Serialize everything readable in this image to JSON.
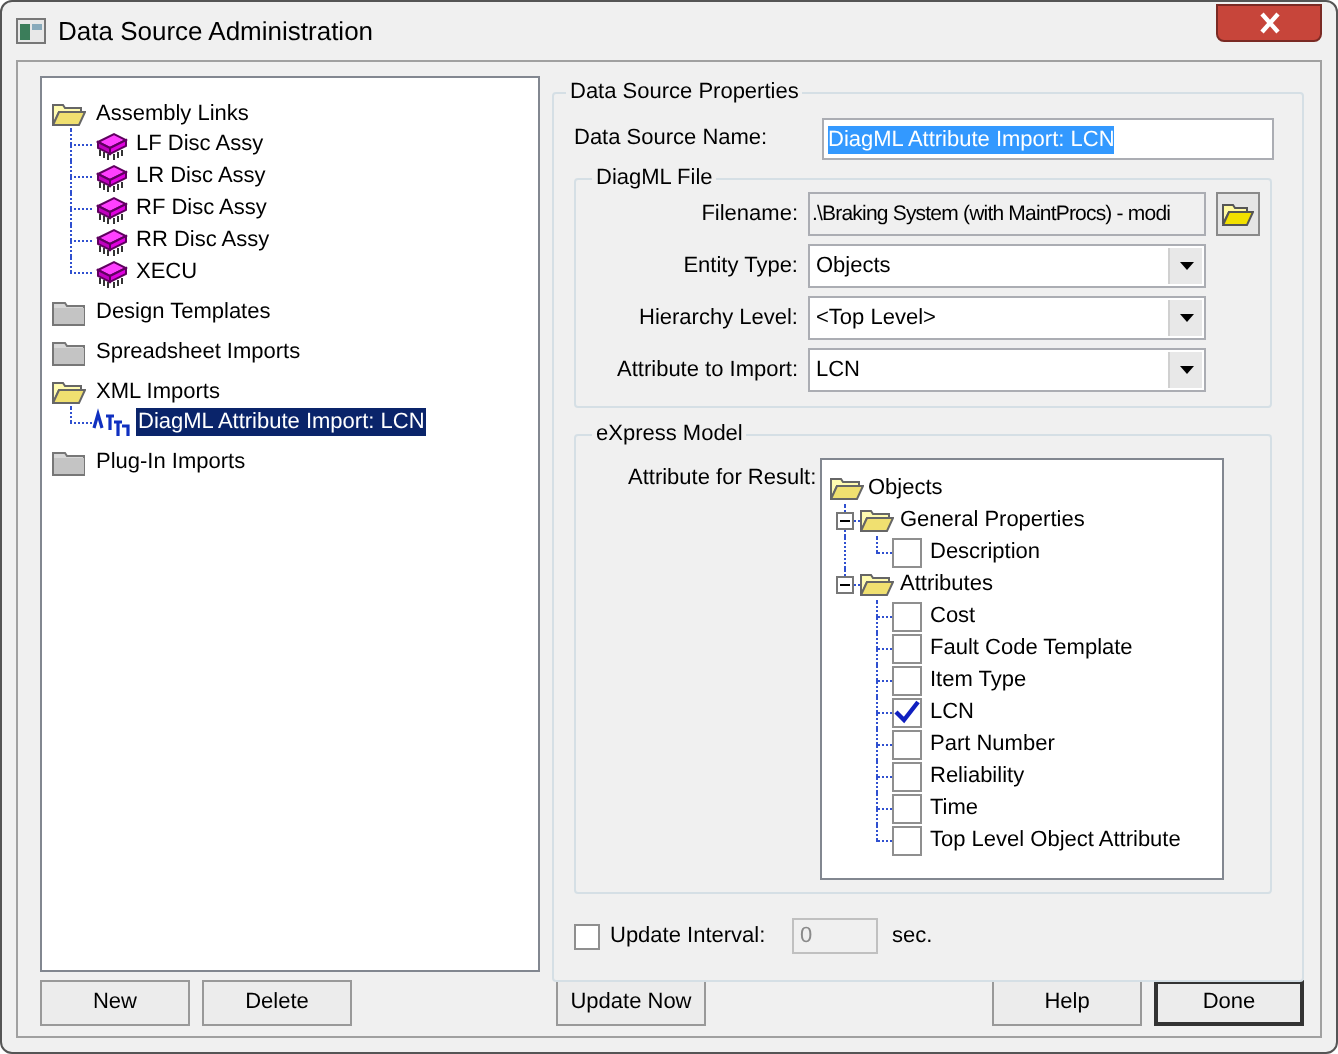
{
  "window": {
    "title": "Data Source Administration"
  },
  "source_tree": [
    {
      "label": "Assembly Links",
      "kind": "folder",
      "expanded": true,
      "selected": false,
      "children": [
        {
          "label": "LF Disc Assy",
          "kind": "assembly",
          "selected": false
        },
        {
          "label": "LR Disc Assy",
          "kind": "assembly",
          "selected": false
        },
        {
          "label": "RF Disc Assy",
          "kind": "assembly",
          "selected": false
        },
        {
          "label": "RR Disc Assy",
          "kind": "assembly",
          "selected": false
        },
        {
          "label": "XECU",
          "kind": "assembly",
          "selected": false
        }
      ]
    },
    {
      "label": "Design Templates",
      "kind": "folder",
      "expanded": false,
      "selected": false
    },
    {
      "label": "Spreadsheet Imports",
      "kind": "folder",
      "expanded": false,
      "selected": false
    },
    {
      "label": "XML Imports",
      "kind": "folder",
      "expanded": true,
      "selected": false,
      "children": [
        {
          "label": "DiagML Attribute Import: LCN",
          "kind": "import",
          "selected": true
        }
      ]
    },
    {
      "label": "Plug-In Imports",
      "kind": "folder",
      "expanded": false,
      "selected": false
    }
  ],
  "properties": {
    "title": "Data Source Properties",
    "name_label": "Data Source Name:",
    "name_value": "DiagML Attribute Import: LCN",
    "name_text_selected": true,
    "diagml_file": {
      "title": "DiagML File",
      "filename_label": "Filename:",
      "filename_value": ".\\Braking System (with MaintProcs) - modi",
      "fields": [
        {
          "label": "Entity Type:",
          "value": "Objects"
        },
        {
          "label": "Hierarchy Level:",
          "value": "<Top Level>"
        },
        {
          "label": "Attribute to Import:",
          "value": "LCN"
        }
      ]
    },
    "model": {
      "title": "eXpress Model",
      "label": "Attribute for Result:",
      "tree": [
        {
          "label": "Objects",
          "kind": "folder",
          "expanded": true,
          "children": [
            {
              "label": "General Properties",
              "kind": "folder",
              "expanded": true,
              "children": [
                {
                  "label": "Description",
                  "kind": "checkbox",
                  "checked": false
                }
              ]
            },
            {
              "label": "Attributes",
              "kind": "folder",
              "expanded": true,
              "children": [
                {
                  "label": "Cost",
                  "kind": "checkbox",
                  "checked": false
                },
                {
                  "label": "Fault Code Template",
                  "kind": "checkbox",
                  "checked": false
                },
                {
                  "label": "Item Type",
                  "kind": "checkbox",
                  "checked": false
                },
                {
                  "label": "LCN",
                  "kind": "checkbox",
                  "checked": true
                },
                {
                  "label": "Part Number",
                  "kind": "checkbox",
                  "checked": false
                },
                {
                  "label": "Reliability",
                  "kind": "checkbox",
                  "checked": false
                },
                {
                  "label": "Time",
                  "kind": "checkbox",
                  "checked": false
                },
                {
                  "label": "Top Level Object Attribute",
                  "kind": "checkbox",
                  "checked": false
                }
              ]
            }
          ]
        }
      ]
    },
    "update_interval": {
      "label": "Update Interval:",
      "checked": false,
      "value": "0",
      "disabled": true,
      "unit": "sec."
    }
  },
  "left_buttons": [
    {
      "label": "New",
      "default": false
    },
    {
      "label": "Delete",
      "default": false
    }
  ],
  "center_buttons": [
    {
      "label": "Update Now",
      "default": false
    }
  ],
  "right_buttons": [
    {
      "label": "Help",
      "default": false
    },
    {
      "label": "Done",
      "default": true
    }
  ]
}
